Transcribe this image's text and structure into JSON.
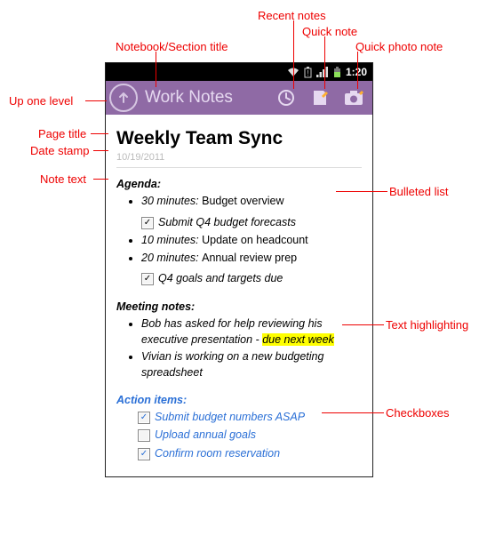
{
  "annotations": {
    "upOneLevel": "Up one level",
    "notebookTitle": "Notebook/Section title",
    "recentNotes": "Recent notes",
    "quickNote": "Quick note",
    "quickPhoto": "Quick photo note",
    "pageTitle": "Page title",
    "dateStamp": "Date stamp",
    "noteText": "Note text",
    "bulleted": "Bulleted list",
    "textHighlight": "Text highlighting",
    "checkboxes": "Checkboxes"
  },
  "status": {
    "clock": "1:20"
  },
  "appBar": {
    "title": "Work Notes"
  },
  "note": {
    "title": "Weekly Team Sync",
    "date": "10/19/2011",
    "agendaHead": "Agenda:",
    "agenda": [
      {
        "time": "30 minutes:",
        "text": "Budget overview"
      },
      {
        "time": "10 minutes:",
        "text": "Update on headcount"
      },
      {
        "time": "20 minutes:",
        "text": "Annual review prep"
      }
    ],
    "agendaChecks": {
      "c1": "Submit Q4 budget forecasts",
      "c2": "Q4 goals and targets due"
    },
    "meetingHead": "Meeting notes:",
    "meeting": {
      "m1a": "Bob has asked for help reviewing his executive presentation - ",
      "m1b": "due next week",
      "m2": "Vivian is working on a new budgeting spreadsheet"
    },
    "actionHead": "Action items:",
    "actions": {
      "a1": "Submit budget numbers ASAP",
      "a2": "Upload annual goals",
      "a3": "Confirm room reservation"
    }
  }
}
